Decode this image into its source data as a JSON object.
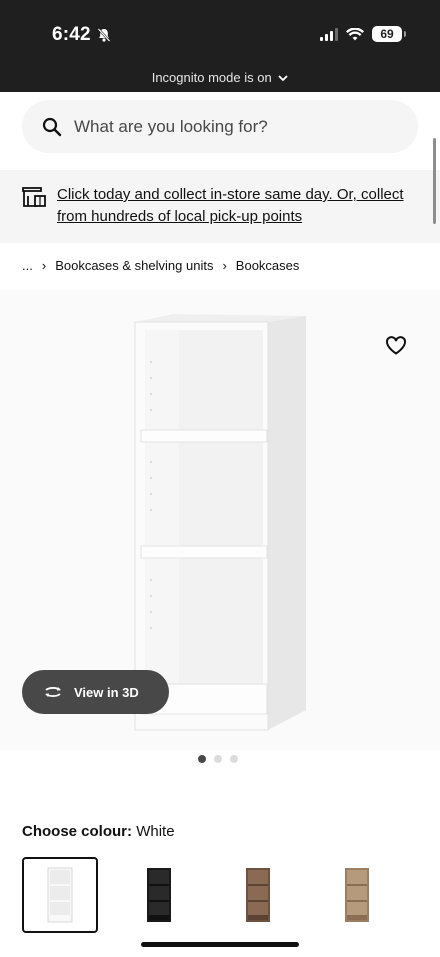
{
  "status_bar": {
    "time": "6:42",
    "battery": "69"
  },
  "browser": {
    "incognito_text": "Incognito mode is on"
  },
  "search": {
    "placeholder": "What are you looking for?"
  },
  "promo": {
    "text": "Click today and collect in-store same day. Or, collect from hundreds of local pick-up points"
  },
  "breadcrumb": {
    "ellipsis": "...",
    "items": [
      "Bookcases & shelving units",
      "Bookcases"
    ]
  },
  "product": {
    "view_3d_label": "View in 3D",
    "image_count": 3,
    "active_image": 1,
    "colour_label": "Choose colour:",
    "colour_value": "White",
    "colour_options": [
      "white-icon",
      "black-icon",
      "dark-brown-icon",
      "light-brown-icon"
    ]
  },
  "colors": {
    "status_bar_bg": "#1f1f1f",
    "chip_bg": "#484848",
    "panel_bg": "#f5f5f5"
  }
}
